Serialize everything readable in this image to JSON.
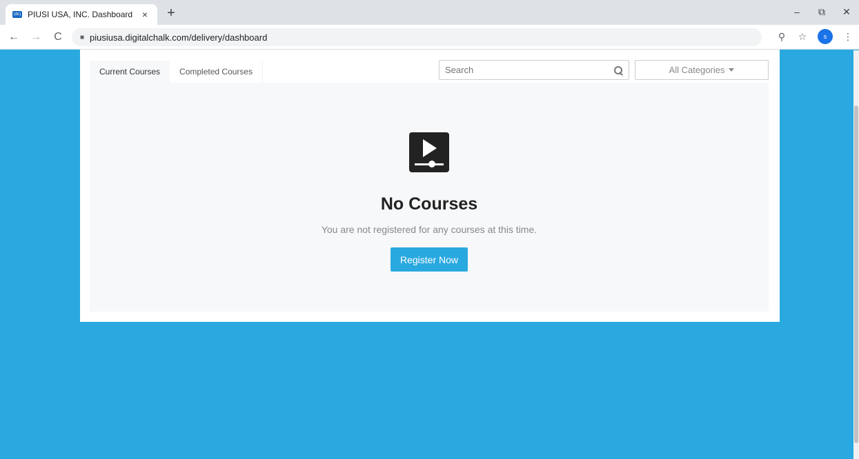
{
  "browser": {
    "tab_title": "PIUSI USA, INC. Dashboard",
    "favicon_text": "(dc)",
    "url": "piusiusa.digitalchalk.com/delivery/dashboard",
    "profile_initial": "s",
    "icons": {
      "back": "←",
      "forward": "→",
      "reload": "C",
      "new_tab": "+",
      "close_tab": "×",
      "minimize": "–",
      "restore": "⧉",
      "close_window": "✕",
      "key": "key-icon",
      "star": "☆",
      "menu": "⋮"
    }
  },
  "dashboard": {
    "tabs": [
      {
        "label": "Current Courses",
        "active": true
      },
      {
        "label": "Completed Courses",
        "active": false
      }
    ],
    "search": {
      "placeholder": "Search"
    },
    "categories": {
      "selected": "All Categories"
    },
    "empty_state": {
      "title": "No Courses",
      "message": "You are not registered for any courses at this time.",
      "button_label": "Register Now"
    }
  },
  "colors": {
    "background": "#2aa9e0",
    "accent": "#2aa9e0",
    "panel": "#f7f8fa"
  }
}
